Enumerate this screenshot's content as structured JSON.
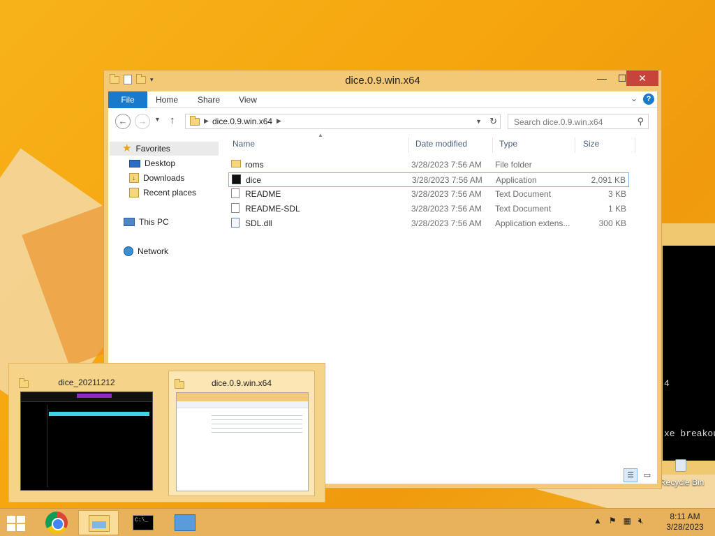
{
  "window": {
    "title": "dice.0.9.win.x64",
    "buttons": {
      "minimize": "—",
      "maximize": "☐",
      "close": "✕"
    }
  },
  "ribbon": {
    "tabs": [
      "File",
      "Home",
      "Share",
      "View"
    ],
    "help": "?",
    "collapse": "⌄"
  },
  "address": {
    "path": "dice.0.9.win.x64",
    "search_placeholder": "Search dice.0.9.win.x64"
  },
  "navpane": {
    "favorites": "Favorites",
    "desktop": "Desktop",
    "downloads": "Downloads",
    "recent": "Recent places",
    "thispc": "This PC",
    "network": "Network"
  },
  "columns": {
    "name": "Name",
    "date": "Date modified",
    "type": "Type",
    "size": "Size"
  },
  "files": [
    {
      "name": "roms",
      "date": "3/28/2023 7:56 AM",
      "type": "File folder",
      "size": "",
      "icon": "folder-icon"
    },
    {
      "name": "dice",
      "date": "3/28/2023 7:56 AM",
      "type": "Application",
      "size": "2,091 KB",
      "icon": "application-icon"
    },
    {
      "name": "README",
      "date": "3/28/2023 7:56 AM",
      "type": "Text Document",
      "size": "3 KB",
      "icon": "text-document-icon"
    },
    {
      "name": "README-SDL",
      "date": "3/28/2023 7:56 AM",
      "type": "Text Document",
      "size": "1 KB",
      "icon": "text-document-icon"
    },
    {
      "name": "SDL.dll",
      "date": "3/28/2023 7:56 AM",
      "type": "Application extens...",
      "size": "300 KB",
      "icon": "dll-icon"
    }
  ],
  "thumbnails": [
    {
      "title": "dice_20211212"
    },
    {
      "title": "dice.0.9.win.x64"
    }
  ],
  "background_terminal": {
    "line1": "4",
    "line2": "xe breakou"
  },
  "desktop": {
    "recycle_bin": "Recycle Bin"
  },
  "taskbar": {
    "cmd_glyph": "C:\\_",
    "clock_time": "8:11 AM",
    "clock_date": "3/28/2023"
  },
  "colors": {
    "accent": "#1979ca",
    "close": "#c7443a",
    "wallpaper": "#f7b21a"
  }
}
